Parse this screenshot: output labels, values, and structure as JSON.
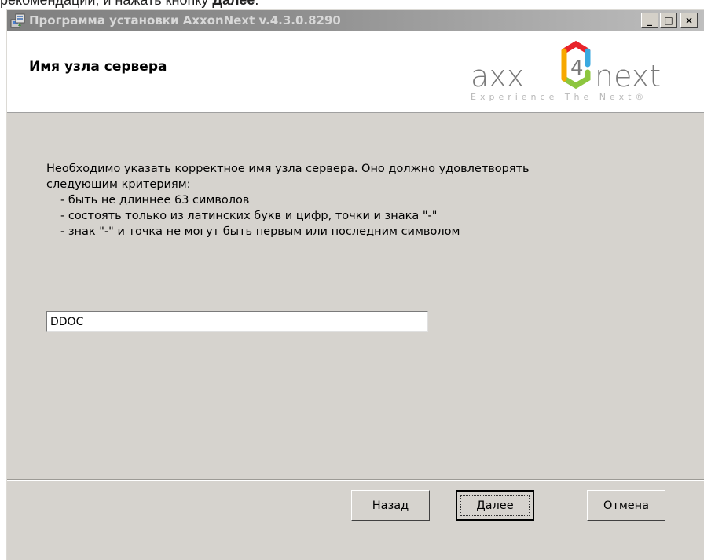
{
  "document": {
    "text_before": "рекомендации, и нажать кнопку ",
    "text_bold": "Далее",
    "text_after": "."
  },
  "window": {
    "title": "Программа установки AxxonNext v.4.3.0.8290",
    "controls": {
      "minimize": "_",
      "maximize": "□",
      "close": "×"
    }
  },
  "header": {
    "page_title": "Имя узла сервера",
    "logo": {
      "brand_left": "axx",
      "brand_digit": "4",
      "brand_right": "next",
      "tagline": "Experience The Next®"
    }
  },
  "main": {
    "description": [
      "Необходимо указать корректное имя узла сервера. Оно должно удовлетворять",
      "следующим критериям:"
    ],
    "criteria": [
      "- быть не длиннее 63 символов",
      "- состоять только из латинских букв и цифр, точки и знака \"-\"",
      "- знак \"-\" и точка не могут быть первым или последним символом"
    ],
    "host_input_value": "DDOC"
  },
  "buttons": {
    "back": "Назад",
    "next": "Далее",
    "cancel": "Отмена"
  },
  "colors": {
    "logo_gray": "#7a7a7a",
    "logo_hex_top": "#e8232a",
    "logo_hex_right": "#3aa9e0",
    "logo_hex_bottom": "#8dc63f",
    "logo_hex_left": "#f7a800"
  }
}
